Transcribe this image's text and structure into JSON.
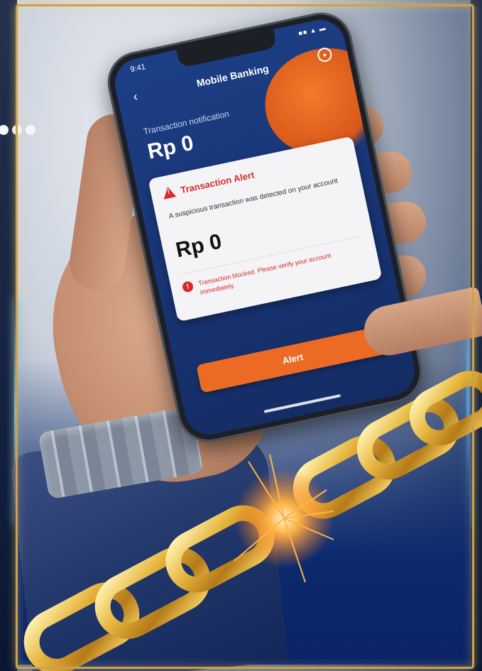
{
  "app": {
    "title": "Mobile Banking",
    "status_time": "9:41",
    "status_icons": "■■ ▲ ▬"
  },
  "transaction": {
    "label": "Transaction notification",
    "amount": "Rp 0"
  },
  "alert": {
    "title": "Transaction Alert",
    "body": "A suspicious transaction was detected on your account",
    "amount": "Rp 0",
    "error_text": "Transaction blocked. Please verify your account immediately.",
    "button_label": "Alert"
  },
  "colors": {
    "accent_orange": "#ec6a23",
    "alert_red": "#d62b2b",
    "screen_blue": "#1d3f86",
    "chain_gold": "#e0ad35",
    "frame_gold": "#c9a24a"
  },
  "icons": {
    "back": "chevron-left-icon",
    "menu": "settings-icon",
    "warning": "warning-icon",
    "error": "error-icon"
  }
}
